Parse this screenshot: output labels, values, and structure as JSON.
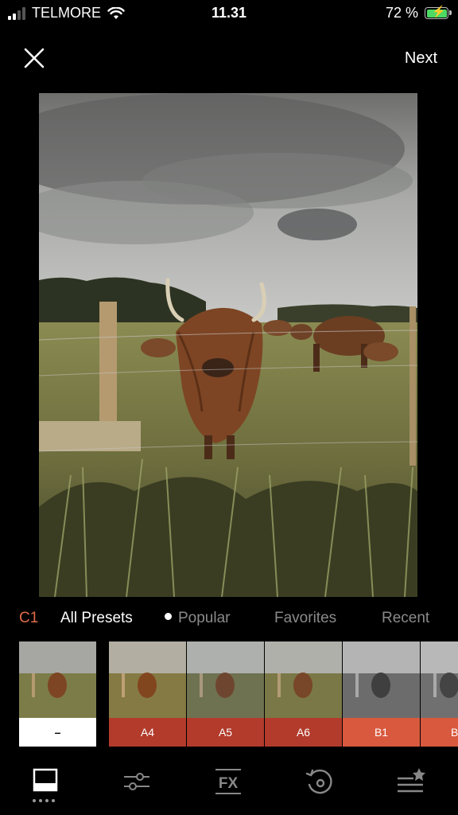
{
  "status": {
    "carrier": "TELMORE",
    "time": "11.31",
    "battery": "72 %"
  },
  "header": {
    "next_label": "Next"
  },
  "tabs": {
    "c1": "C1",
    "all": "All Presets",
    "popular": "Popular",
    "favorites": "Favorites",
    "recent": "Recent"
  },
  "presets": [
    {
      "label": "–",
      "color": "#ffffff",
      "text_color": "#000000"
    },
    {
      "label": "A4",
      "color": "#b23b2c",
      "text_color": "#ffffff"
    },
    {
      "label": "A5",
      "color": "#b23b2c",
      "text_color": "#ffffff"
    },
    {
      "label": "A6",
      "color": "#b23b2c",
      "text_color": "#ffffff"
    },
    {
      "label": "B1",
      "color": "#d9593e",
      "text_color": "#ffffff"
    },
    {
      "label": "B",
      "color": "#d9593e",
      "text_color": "#ffffff"
    }
  ],
  "colors": {
    "accent": "#e06b4a",
    "inactive_tab": "#8a8a8a",
    "background": "#000000"
  },
  "toolbar_icons": [
    "presets-icon",
    "adjust-sliders-icon",
    "fx-icon",
    "history-icon",
    "recipes-icon"
  ]
}
